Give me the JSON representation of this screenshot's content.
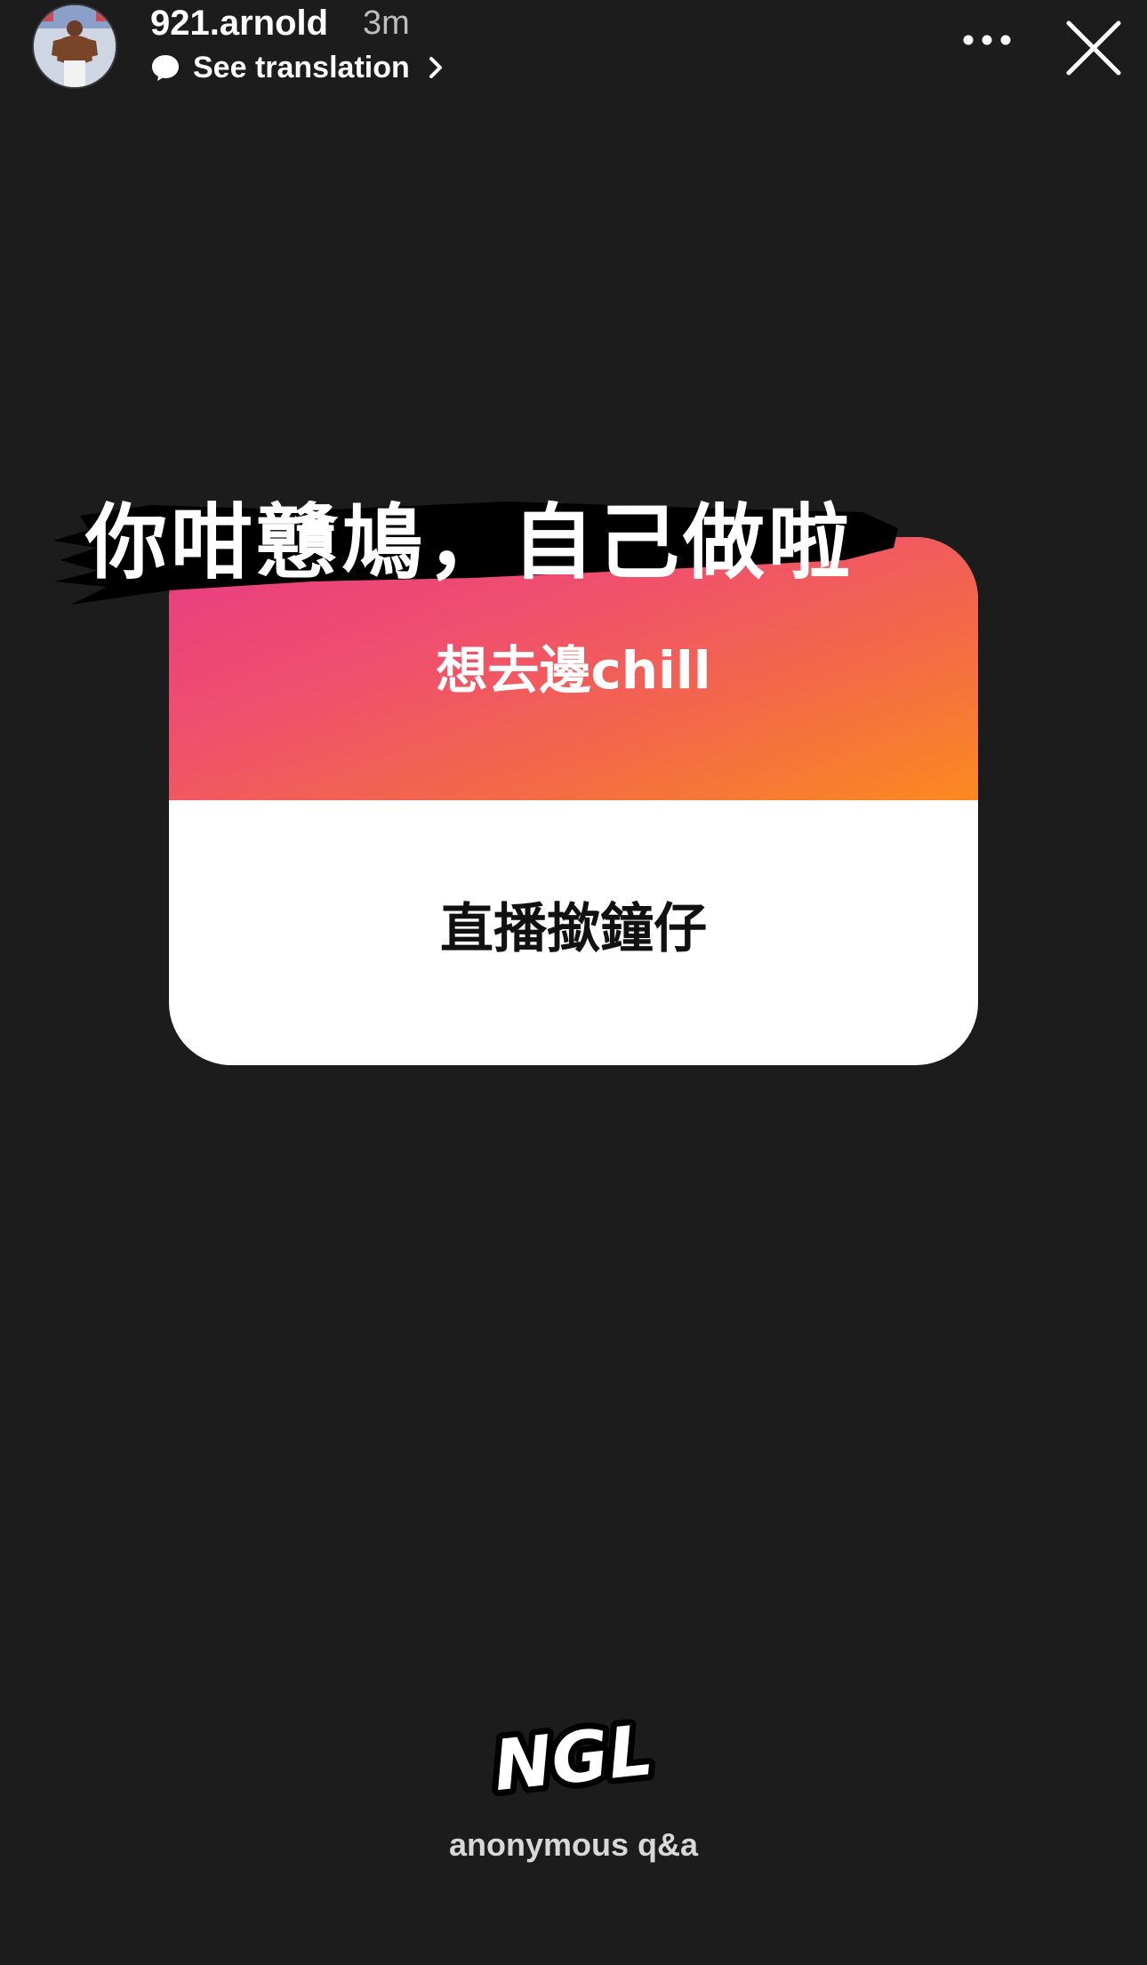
{
  "header": {
    "username": "921.arnold",
    "time": "3m",
    "translation_label": "See translation",
    "avatar_icon": "profile-photo-icon",
    "more_icon": "more-horizontal-icon",
    "close_icon": "close-icon"
  },
  "story": {
    "caption": "你咁戇鳩，自己做啦",
    "card": {
      "prompt": "想去邊chill",
      "answer": "直播撳鐘仔",
      "gradient_colors": [
        "#e63a86",
        "#f0526a",
        "#f46b45",
        "#fb8a20"
      ]
    },
    "brand": {
      "logo_text": "NGL",
      "tagline": "anonymous q&a"
    }
  },
  "colors": {
    "background": "#1c1c1d",
    "card_bg": "#ffffff",
    "brush": "#000000"
  }
}
